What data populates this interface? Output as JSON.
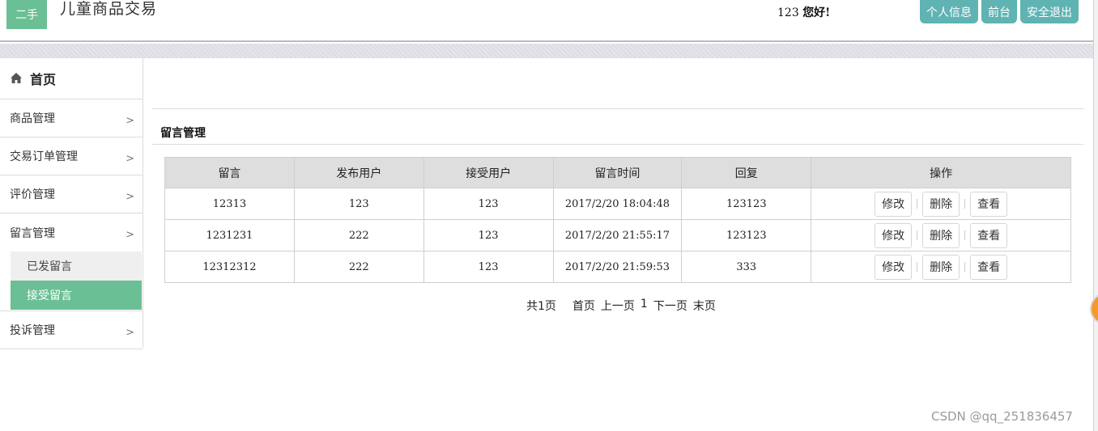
{
  "header": {
    "logo_text": "二手",
    "site_title": "儿童商品交易",
    "greeting_user": "123",
    "greeting_text": "您好!",
    "buttons": [
      "个人信息",
      "前台",
      "安全退出"
    ],
    "accent_color": "#6bbf94",
    "button_color": "#5fb3b3"
  },
  "sidebar": {
    "home_label": "首页",
    "items": [
      {
        "label": "商品管理",
        "arrow": ">"
      },
      {
        "label": "交易订单管理",
        "arrow": ">"
      },
      {
        "label": "评价管理",
        "arrow": ">"
      },
      {
        "label": "留言管理",
        "arrow": ">"
      }
    ],
    "submenu": [
      "已发留言",
      "接受留言"
    ],
    "last_item": {
      "label": "投诉管理",
      "arrow": ">"
    }
  },
  "main": {
    "section_title": "留言管理",
    "columns": [
      "留言",
      "发布用户",
      "接受用户",
      "留言时间",
      "回复",
      "操作"
    ],
    "rows": [
      [
        "12313",
        "123",
        "123",
        "2017/2/20 18:04:48",
        "123123"
      ],
      [
        "1231231",
        "222",
        "123",
        "2017/2/20 21:55:17",
        "123123"
      ],
      [
        "12312312",
        "222",
        "123",
        "2017/2/20 21:59:53",
        "333"
      ]
    ],
    "row_actions": [
      "修改",
      "删除",
      "查看"
    ],
    "pager": {
      "total": "共1页",
      "first": "首页",
      "prev": "上一页",
      "current": "1",
      "next": "下一页",
      "last": "末页"
    }
  },
  "watermark": "CSDN @qq_251836457"
}
